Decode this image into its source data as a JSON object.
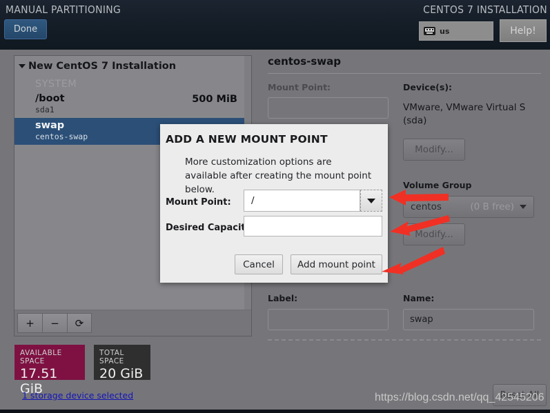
{
  "topbar": {
    "title": "MANUAL PARTITIONING",
    "right_title": "CENTOS 7 INSTALLATION",
    "done_label": "Done",
    "keyboard_layout": "us",
    "help_label": "Help!"
  },
  "left_panel": {
    "header": "New CentOS 7 Installation",
    "group_label": "SYSTEM",
    "rows": [
      {
        "name": "/boot",
        "device": "sda1",
        "size": "500 MiB",
        "selected": false
      },
      {
        "name": "swap",
        "device": "centos-swap",
        "size": "",
        "selected": true
      }
    ],
    "toolbar": {
      "add": "+",
      "remove": "−",
      "refresh": "⟳"
    }
  },
  "space": {
    "available_caption": "AVAILABLE SPACE",
    "available_value": "17.51 GiB",
    "available_color": "#7e1142",
    "total_caption": "TOTAL SPACE",
    "total_value": "20 GiB",
    "total_color": "#2f2f2f",
    "storage_link": "1 storage device selected"
  },
  "right_panel": {
    "title": "centos-swap",
    "mount_point_label": "Mount Point:",
    "mount_point_value": "",
    "devices_label": "Device(s):",
    "devices_value": "VMware, VMware Virtual S (sda)",
    "device_modify_label": "Modify...",
    "volume_group_label": "Volume Group",
    "volume_group_value": "centos",
    "volume_group_free": "(0 B free)",
    "vg_modify_label": "Modify...",
    "label_label": "Label:",
    "label_value": "",
    "name_label": "Name:",
    "name_value": "swap"
  },
  "modal": {
    "title": "ADD A NEW MOUNT POINT",
    "subtitle": "More customization options are available after creating the mount point below.",
    "mount_point_label": "Mount Point:",
    "mount_point_value": "/",
    "mount_point_placeholder": "",
    "desired_capacity_label": "Desired Capacity:",
    "desired_capacity_value": "",
    "desired_capacity_placeholder": "",
    "cancel_label": "Cancel",
    "submit_label": "Add mount point"
  },
  "footer": {
    "reset_label": "Reset All",
    "watermark": "https://blog.csdn.net/qq_42545206"
  },
  "annotations": {
    "arrow_color": "#f03024",
    "count": 3
  }
}
